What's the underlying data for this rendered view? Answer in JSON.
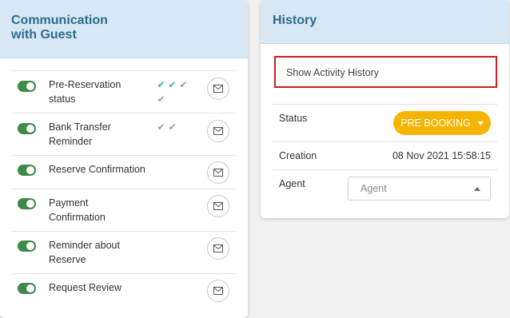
{
  "communication": {
    "title_line1": "Communication",
    "title_line2": "with Guest",
    "items": [
      {
        "label_line1": "Pre-Reservation",
        "label_line2": "status",
        "enabled": true,
        "checks": [
          "blue",
          "blue",
          "grey",
          "grey"
        ]
      },
      {
        "label_line1": "Bank Transfer",
        "label_line2": "Reminder",
        "enabled": true,
        "checks": [
          "grey",
          "grey"
        ]
      },
      {
        "label_line1": "Reserve Confirmation",
        "label_line2": "",
        "enabled": true,
        "checks": []
      },
      {
        "label_line1": "Payment",
        "label_line2": "Confirmation",
        "enabled": true,
        "checks": []
      },
      {
        "label_line1": "Reminder about",
        "label_line2": "Reserve",
        "enabled": true,
        "checks": []
      },
      {
        "label_line1": "Request Review",
        "label_line2": "",
        "enabled": true,
        "checks": []
      }
    ]
  },
  "history": {
    "title": "History",
    "activity_link": "Show Activity History",
    "status_label": "Status",
    "status_value": "PRE BOOKING",
    "creation_label": "Creation",
    "creation_value": "08 Nov 2021 15:58:15",
    "agent_label": "Agent",
    "agent_placeholder": "Agent"
  },
  "colors": {
    "header_bg": "#d7e8f4",
    "header_text": "#2d6b8f",
    "toggle_on": "#3e8a4a",
    "check_sent": "#3fa9c9",
    "check_pending": "#999999",
    "status_button": "#f5b400",
    "highlight_border": "#d01d1d"
  },
  "icons": {
    "toggle": "toggle-switch-icon",
    "check": "checkmark-icon",
    "mail": "envelope-icon",
    "dropdown_open": "caret-up-icon",
    "dropdown_closed": "caret-down-icon"
  }
}
